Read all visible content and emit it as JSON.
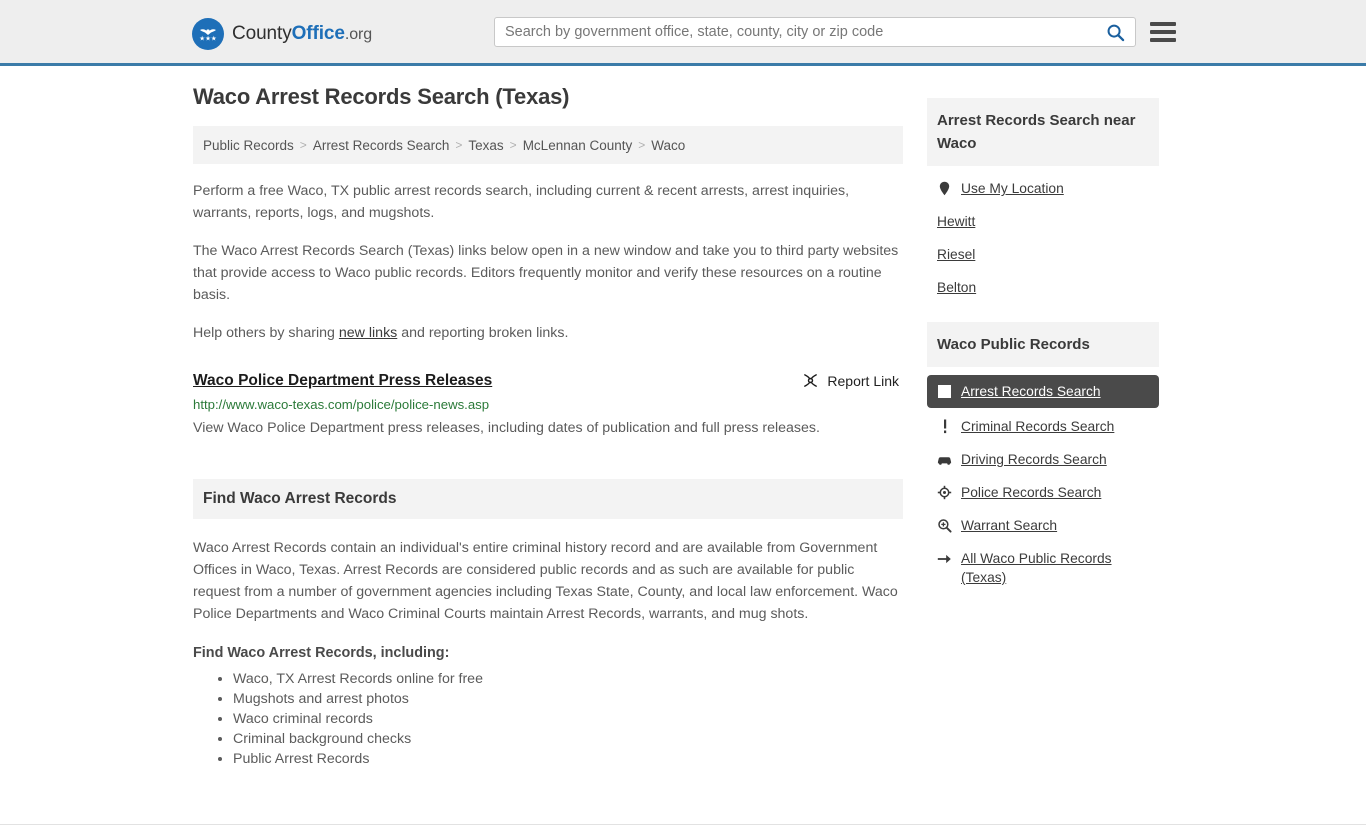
{
  "header": {
    "brand": {
      "part1": "County",
      "part2": "Office",
      "part3": ".org",
      "logo_icon": "eagle-stars-logo"
    },
    "search": {
      "placeholder": "Search by government office, state, county, city or zip code",
      "value": ""
    },
    "search_icon": "search-icon",
    "menu_icon": "hamburger-menu-icon",
    "accent_color": "#3b7ba8"
  },
  "main": {
    "title": "Waco Arrest Records Search (Texas)",
    "breadcrumb": [
      "Public Records",
      "Arrest Records Search",
      "Texas",
      "McLennan County",
      "Waco"
    ],
    "breadcrumb_separator": ">",
    "paragraphs": [
      "Perform a free Waco, TX public arrest records search, including current & recent arrests, arrest inquiries, warrants, reports, logs, and mugshots.",
      "The Waco Arrest Records Search (Texas) links below open in a new window and take you to third party websites that provide access to Waco public records. Editors frequently monitor and verify these resources on a routine basis."
    ],
    "share_line": {
      "before": "Help others by sharing ",
      "link": "new links",
      "after": " and reporting broken links."
    },
    "result": {
      "title": "Waco Police Department Press Releases",
      "url": "http://www.waco-texas.com/police/police-news.asp",
      "description": "View Waco Police Department press releases, including dates of publication and full press releases.",
      "report_label": "Report Link",
      "report_icon": "broken-link-icon",
      "url_color": "#2b7a39"
    },
    "section": {
      "heading": "Find Waco Arrest Records",
      "body": "Waco Arrest Records contain an individual's entire criminal history record and are available from Government Offices in Waco, Texas. Arrest Records are considered public records and as such are available for public request from a number of government agencies including Texas State, County, and local law enforcement. Waco Police Departments and Waco Criminal Courts maintain Arrest Records, warrants, and mug shots.",
      "subheading": "Find Waco Arrest Records, including:",
      "bullets": [
        "Waco, TX Arrest Records online for free",
        "Mugshots and arrest photos",
        "Waco criminal records",
        "Criminal background checks",
        "Public Arrest Records"
      ]
    }
  },
  "sidebar": {
    "near_card": {
      "heading": "Arrest Records Search near Waco",
      "items": [
        {
          "label": "Use My Location",
          "icon": "map-pin-icon",
          "active": false
        },
        {
          "label": "Hewitt",
          "icon": "",
          "active": false
        },
        {
          "label": "Riesel",
          "icon": "",
          "active": false
        },
        {
          "label": "Belton",
          "icon": "",
          "active": false
        }
      ]
    },
    "records_card": {
      "heading": "Waco Public Records",
      "active_bg": "#4a4a4a",
      "items": [
        {
          "label": "Arrest Records Search",
          "icon": "square-document-icon",
          "active": true
        },
        {
          "label": "Criminal Records Search",
          "icon": "exclamation-icon",
          "active": false
        },
        {
          "label": "Driving Records Search",
          "icon": "car-icon",
          "active": false
        },
        {
          "label": "Police Records Search",
          "icon": "police-badge-icon",
          "active": false
        },
        {
          "label": "Warrant Search",
          "icon": "magnifier-plus-icon",
          "active": false
        },
        {
          "label": "All Waco Public Records (Texas)",
          "icon": "arrow-right-icon",
          "active": false
        }
      ]
    }
  }
}
